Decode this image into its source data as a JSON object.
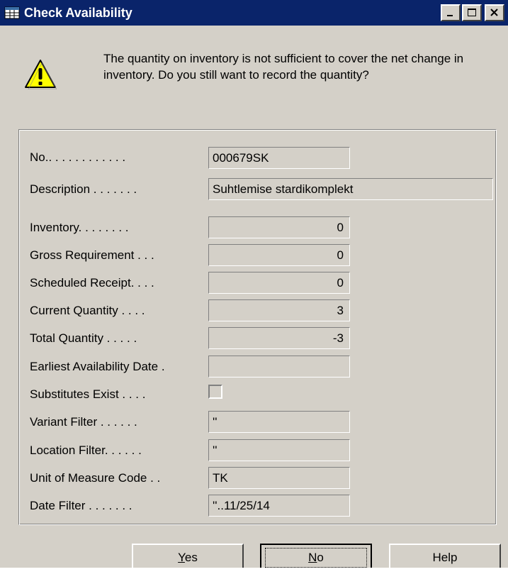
{
  "window": {
    "title": "Check Availability",
    "icons": {
      "app": "table-icon",
      "minimize": "minimize-icon",
      "maximize": "maximize-icon",
      "close": "close-icon",
      "warning": "warning-icon"
    }
  },
  "message": "The quantity on inventory is not sufficient to cover the net change in inventory. Do you still want to record the quantity?",
  "fields": {
    "no_label": "No.. . . . . . . . . . . .",
    "no_value": "000679SK",
    "description_label": "Description . . . . . . .",
    "description_value": "Suhtlemise stardikomplekt",
    "inventory_label": "Inventory. . . . . . . .",
    "inventory_value": "0",
    "gross_label": "Gross Requirement . . .",
    "gross_value": "0",
    "scheduled_label": "Scheduled Receipt. . . .",
    "scheduled_value": "0",
    "current_label": "Current Quantity . . . .",
    "current_value": "3",
    "total_label": "Total Quantity . . . . .",
    "total_value": "-3",
    "earliest_label": "Earliest Availability Date .",
    "earliest_value": "",
    "substitutes_label": "Substitutes Exist . . . .",
    "substitutes_checked": false,
    "variant_label": "Variant Filter . . . . . .",
    "variant_value": "''",
    "location_label": "Location Filter. . . . . .",
    "location_value": "''",
    "uom_label": "Unit of Measure Code . .",
    "uom_value": "TK",
    "date_label": "Date Filter . . . . . . .",
    "date_value": "''..11/25/14"
  },
  "buttons": {
    "yes_mnemonic": "Y",
    "yes_rest": "es",
    "no_mnemonic": "N",
    "no_rest": "o",
    "help": "Help"
  },
  "colors": {
    "titlebar": "#0a246a",
    "face": "#d4d0c8",
    "warning_fill": "#ffff00"
  }
}
